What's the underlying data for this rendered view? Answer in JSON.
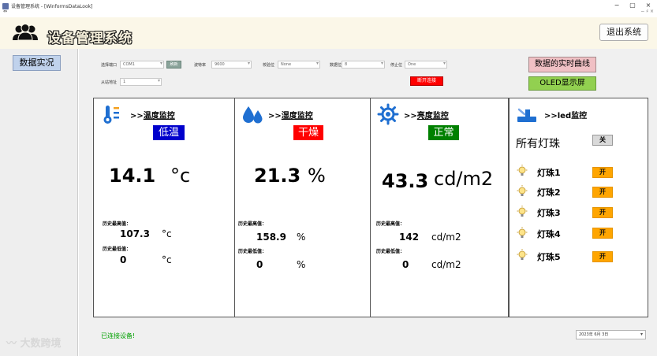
{
  "window": {
    "title": "设备管理系统 - [WinformsDataLook]",
    "minimize": "−",
    "maximize": "▢",
    "close": "×",
    "menu_glyph": "⇔",
    "right_glyph": "− ♯ ×"
  },
  "header": {
    "system_title": "设备管理系统",
    "exit_label": "退出系统"
  },
  "sidebar": {
    "data_button_label": "数据实况"
  },
  "watermark": "大数跨境",
  "serial_config": {
    "port_label": "选择端口",
    "port_value": "COM1",
    "refresh_label": "刷新",
    "baud_label": "波特率",
    "baud_value": "9600",
    "parity_label": "校验位",
    "parity_value": "None",
    "databits_label": "数据位",
    "databits_value": "8",
    "stopbits_label": "停止位",
    "stopbits_value": "One",
    "slave_label": "从站地址",
    "slave_value": "1",
    "disconnect_label": "断开连接"
  },
  "actions": {
    "curve_label": "数据的实时曲线",
    "oled_label": "OLED显示屏"
  },
  "temperature": {
    "title_prefix": ">>",
    "title": "温度监控",
    "status": "低温",
    "value": "14.1",
    "unit": "°c",
    "hist_high_label": "历史最高值：",
    "hist_high_value": "107.3",
    "hist_high_unit": "°c",
    "hist_low_label": "历史最低值：",
    "hist_low_value": "0",
    "hist_low_unit": "°c"
  },
  "humidity": {
    "title_prefix": ">>",
    "title": "湿度监控",
    "status": "干燥",
    "value": "21.3",
    "unit": "%",
    "hist_high_label": "历史最高值：",
    "hist_high_value": "158.9",
    "hist_high_unit": "%",
    "hist_low_label": "历史最低值：",
    "hist_low_value": "0",
    "hist_low_unit": "%"
  },
  "brightness": {
    "title_prefix": ">>",
    "title": "亮度监控",
    "status": "正常",
    "value": "43.3",
    "unit": "cd/m2",
    "hist_high_label": "历史最高值：",
    "hist_high_value": "142",
    "hist_high_unit": "cd/m2",
    "hist_low_label": "历史最低值：",
    "hist_low_value": "0",
    "hist_low_unit": "cd/m2"
  },
  "led": {
    "title": ">>led监控",
    "all_label": "所有灯珠",
    "all_state": "关",
    "items": [
      {
        "name": "灯珠1",
        "state": "开"
      },
      {
        "name": "灯珠2",
        "state": "开"
      },
      {
        "name": "灯珠3",
        "state": "开"
      },
      {
        "name": "灯珠4",
        "state": "开"
      },
      {
        "name": "灯珠5",
        "state": "开"
      }
    ]
  },
  "footer": {
    "connect_status": "已连接设备!",
    "date_value": "2023年 6月 3日",
    "date_dropdown": "▾"
  },
  "colors": {
    "status_low": "#0000cc",
    "status_dry": "#ff0000",
    "status_normal": "#008000",
    "led_on": "#ffa500",
    "icon_blue": "#1f6fd1"
  }
}
